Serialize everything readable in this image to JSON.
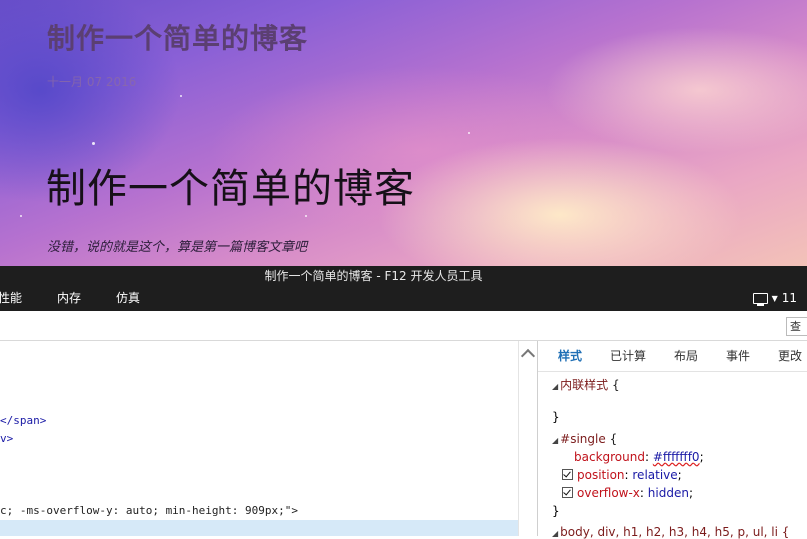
{
  "blog": {
    "title": "制作一个简单的博客",
    "subtitle": "十一月 07 2016",
    "post_title": "制作一个简单的博客",
    "post_description": "没错，说的就是这个，算是第一篇博客文章吧"
  },
  "devtools": {
    "window_title": "制作一个简单的博客 - F12 开发人员工具",
    "tabs": [
      "性能",
      "内存",
      "仿真"
    ],
    "emulation_badge": "11",
    "search_placeholder": "查",
    "dom_lines": {
      "line1": "</span>",
      "line2": "v>",
      "line3": "c; -ms-overflow-y: auto; min-height: 909px;\">"
    },
    "style_tabs": [
      "样式",
      "已计算",
      "布局",
      "事件",
      "更改"
    ],
    "rules": {
      "inline_selector": "内联样式",
      "inline_open": "{",
      "inline_close": "}",
      "single_selector": "#single",
      "single_open": "{",
      "bg_prop": "background",
      "bg_val": "#fffffff0",
      "pos_prop": "position",
      "pos_val": "relative",
      "ovf_prop": "overflow-x",
      "ovf_val": "hidden",
      "single_close": "}",
      "body_selector": "body, div, h1, h2, h3, h4, h5, p, ul, li {"
    }
  },
  "colors": {
    "accent": "#1f6fb5",
    "devtools_dark": "#1e1e1e",
    "selected_row": "#d6e9f8"
  }
}
